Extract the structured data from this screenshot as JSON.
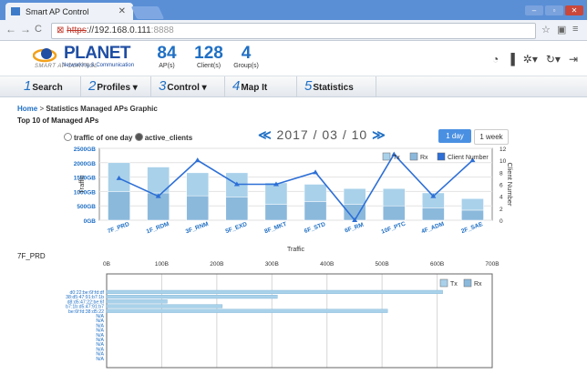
{
  "browser": {
    "tab_title": "Smart AP Control",
    "url_scheme": "https",
    "url_host": "://192.168.0.111",
    "url_port": ":8888"
  },
  "header": {
    "brand": "PLANET",
    "brand_sub": "Networking & Communication",
    "tagline": "SMART AP CONTROL",
    "stats": [
      {
        "value": "84",
        "label": "AP(s)"
      },
      {
        "value": "128",
        "label": "Client(s)"
      },
      {
        "value": "4",
        "label": "Group(s)"
      }
    ]
  },
  "menu": [
    {
      "num": "1",
      "label": "Search"
    },
    {
      "num": "2",
      "label": "Profiles ▾"
    },
    {
      "num": "3",
      "label": "Control ▾"
    },
    {
      "num": "4",
      "label": "Map It"
    },
    {
      "num": "5",
      "label": "Statistics"
    }
  ],
  "breadcrumb": {
    "home": "Home",
    "sep": " > ",
    "current": "Statistics Managed APs Graphic"
  },
  "section_title": "Top 10 of Managed APs",
  "filters": {
    "traffic_label": "traffic of one day",
    "clients_label": "active_clients",
    "selected": "active_clients"
  },
  "date_nav": {
    "prev": "≪",
    "date": "2017 / 03 / 10",
    "next": "≫"
  },
  "range_buttons": {
    "day": "1 day",
    "week": "1 week",
    "selected": "day"
  },
  "colors": {
    "tx": "#a9d1ea",
    "rx": "#8bb9dc",
    "line": "#2d6fd6",
    "accent": "#1f6fc4"
  },
  "chart_data": [
    {
      "type": "bar",
      "categories": [
        "7F_PRD",
        "1F_RDM",
        "3F_RNM",
        "5F_EXD",
        "8F_MKT",
        "6F_STD",
        "6F_RM",
        "10F_PTC",
        "4F_ADM",
        "2F_SAE"
      ],
      "series": [
        {
          "name": "Tx",
          "values": [
            1000,
            900,
            800,
            850,
            750,
            600,
            550,
            600,
            520,
            400
          ]
        },
        {
          "name": "Rx",
          "values": [
            1000,
            950,
            850,
            800,
            550,
            650,
            550,
            500,
            430,
            350
          ]
        },
        {
          "name": "Client Number",
          "type": "line",
          "values": [
            7,
            4,
            10,
            6,
            6,
            8,
            0,
            11,
            4,
            10
          ]
        }
      ],
      "xlabel": "Traffic",
      "ylabel": "Traffic",
      "y2label": "Client Number",
      "yticks": [
        "0GB",
        "500GB",
        "1000GB",
        "1500GB",
        "2000GB",
        "2500GB"
      ],
      "ylim": [
        0,
        2500
      ],
      "y2ticks": [
        "0",
        "2",
        "4",
        "6",
        "8",
        "10",
        "12"
      ],
      "y2lim": [
        0,
        12
      ],
      "legend": [
        "Tx",
        "Rx",
        "Client Number"
      ],
      "legend_position": "top-right",
      "grid": true
    },
    {
      "type": "bar",
      "orientation": "horizontal",
      "title": "7F_PRD",
      "categories": [
        "d0:22:be:6f:fd:df",
        "38:d5:47:91:b7:1b",
        "d8:d5:47:22:be:6f",
        "b7:1b:d5:47:91:b7",
        "be:6f:fd:38:d5:22",
        "N/A",
        "N/A",
        "N/A",
        "N/A",
        "N/A",
        "N/A",
        "N/A",
        "N/A",
        "N/A",
        "N/A"
      ],
      "series": [
        {
          "name": "Tx",
          "values": [
            610,
            310,
            110,
            210,
            510,
            0,
            0,
            0,
            0,
            0,
            0,
            0,
            0,
            0,
            0
          ]
        },
        {
          "name": "Rx",
          "values": [
            0,
            0,
            0,
            0,
            0,
            0,
            0,
            0,
            0,
            0,
            0,
            0,
            0,
            0,
            0
          ]
        }
      ],
      "xticks": [
        "0B",
        "100B",
        "200B",
        "300B",
        "400B",
        "500B",
        "600B",
        "700B"
      ],
      "xlim": [
        0,
        700
      ],
      "legend": [
        "Tx",
        "Rx"
      ],
      "legend_position": "top-right",
      "grid": true
    }
  ]
}
